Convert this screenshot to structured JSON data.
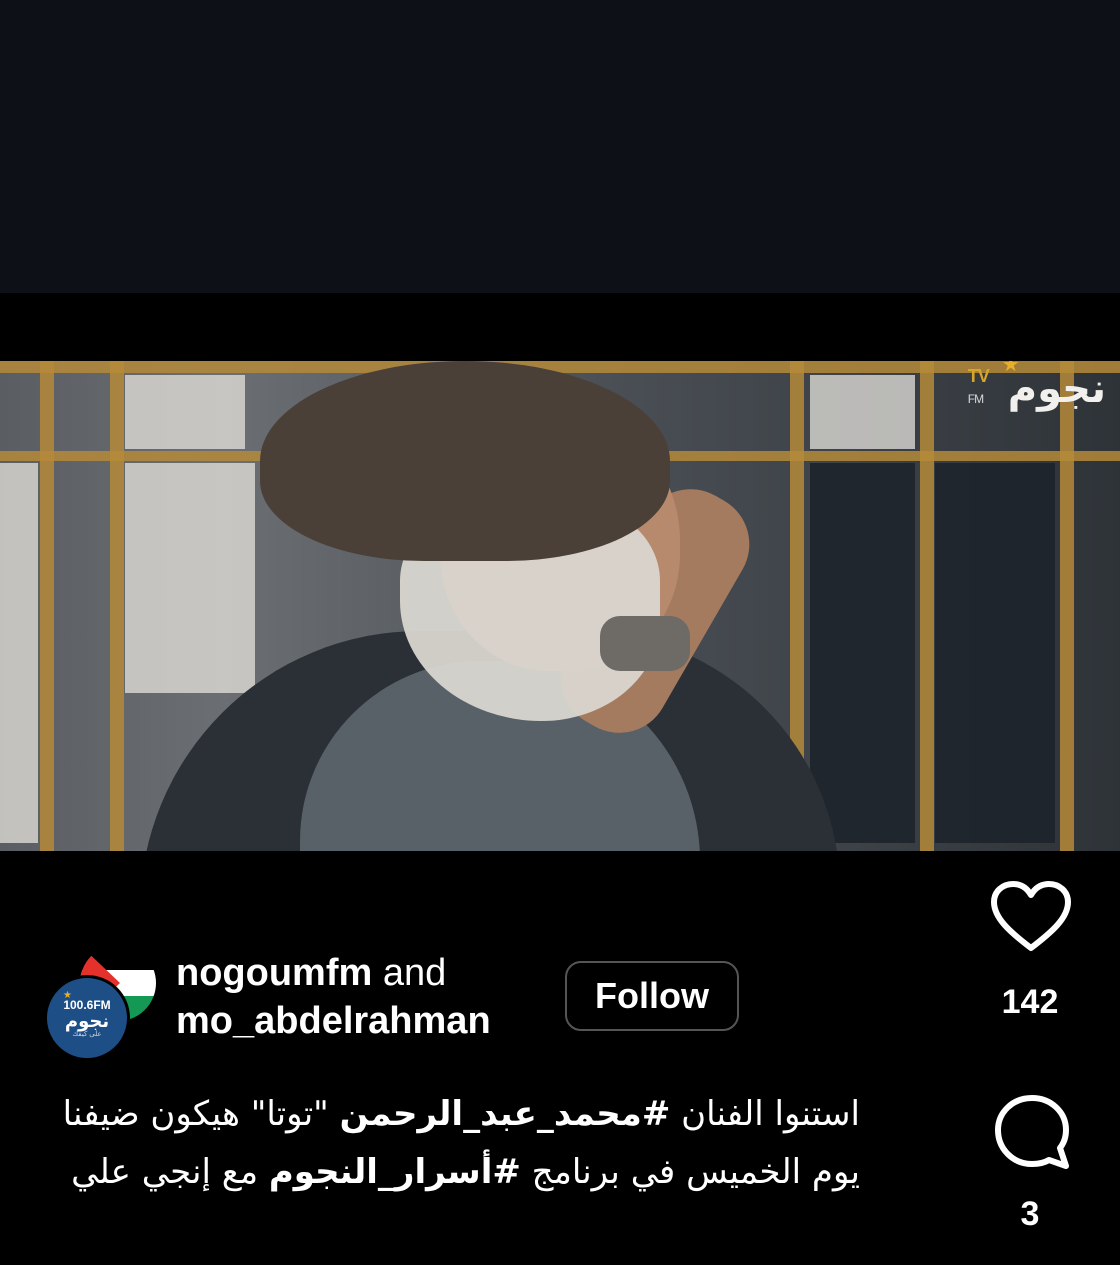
{
  "video": {
    "watermark_brand": "نجوم",
    "watermark_tv": "TV",
    "watermark_fm": "FM"
  },
  "post": {
    "author_primary": "nogoumfm",
    "conjunction": "and",
    "author_secondary": "mo_abdelrahman",
    "follow_label": "Follow",
    "avatar_freq": "100.6FM",
    "avatar_brand": "نجوم",
    "avatar_tagline": "على كيفك",
    "caption": {
      "part1": "استنوا الفنان ",
      "hashtag1": "#محمد_عبد_الرحمن",
      "part2": " \"توتا\" هيكون ضيفنا يوم الخميس في برنامج ",
      "hashtag2": "#أسرار_النجوم",
      "part3": " مع إنجي علي"
    }
  },
  "actions": {
    "like_icon": "heart-outline-icon",
    "like_count": "142",
    "comment_icon": "comment-bubble-icon",
    "comment_count": "3"
  }
}
